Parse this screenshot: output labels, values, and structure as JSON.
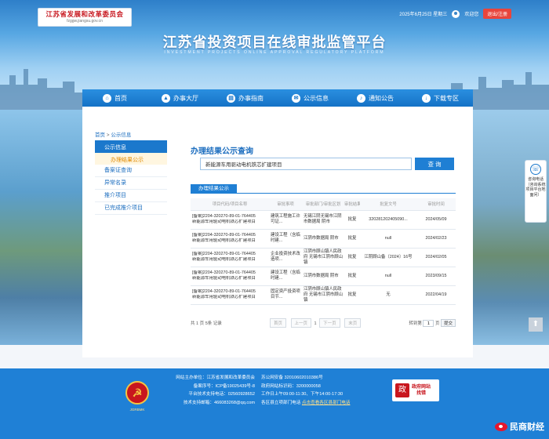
{
  "header": {
    "logo_cn": "江苏省发展和改革委员会",
    "logo_en": "fzggw.jiangsu.gov.cn",
    "date": "2025年6月25日 星期三",
    "welcome": "欢迎您",
    "logout": "退出/注册",
    "site_title": "江苏省投资项目在线审批监管平台",
    "site_subtitle": "INVESTMENT PROJECTS ONLINE APPROVAL REGULATORY PLATFORM"
  },
  "nav": {
    "items": [
      {
        "label": "首页",
        "icon": "home-icon",
        "glyph": "⌂"
      },
      {
        "label": "办事大厅",
        "icon": "hall-icon",
        "glyph": "▲"
      },
      {
        "label": "办事指南",
        "icon": "guide-icon",
        "glyph": "▤"
      },
      {
        "label": "公示信息",
        "icon": "notice-icon",
        "glyph": "✉"
      },
      {
        "label": "通知公告",
        "icon": "announcement-icon",
        "glyph": "♪"
      },
      {
        "label": "下载专区",
        "icon": "download-icon",
        "glyph": "↓"
      }
    ]
  },
  "breadcrumb": {
    "home": "首页",
    "sep": " > ",
    "current": "公示信息"
  },
  "sidebar": {
    "head": "公示信息",
    "active_sub": "办理结果公示",
    "items": [
      "备案证查询",
      "异常名录",
      "推介项目",
      "已完成推介项目"
    ]
  },
  "main": {
    "title": "办理结果公示查询",
    "search_value": "新能源车用驱动电机铁芯扩建项目",
    "search_button": "查 询",
    "tab": "办理结果公示"
  },
  "table": {
    "headers": [
      "项目代码/项目名称",
      "审批事项",
      "审批部门/审批区划",
      "审批结果",
      "批复文号",
      "审批时间"
    ],
    "rows": [
      {
        "code": "[备案]2204-320270-89-01-764405",
        "name": "新能源车用驱动电机铁芯扩建项目",
        "item": "建筑工程施工许可证...",
        "dept": "无锡江阴无锡市江阴市数据局 阴市",
        "result": "批复",
        "doc": "320281202405090...",
        "date": "2024/05/09"
      },
      {
        "code": "[备案]2204-320270-89-01-764405",
        "name": "新能源车用驱动电机铁芯扩建项目",
        "item": "建设工程（含临时建...",
        "dept": "江阴市数据局 阴市",
        "result": "批复",
        "doc": "null",
        "date": "2024/02/23"
      },
      {
        "code": "[备案]2204-320270-89-01-764405",
        "name": "新能源车用驱动电机铁芯扩建项目",
        "item": "企业投资技术改造项...",
        "dept": "江阴市顾山镇人民政府 无锡市江阴市顾山镇",
        "result": "批复",
        "doc": "江阴顾山备〔2024〕16号",
        "date": "2024/02/05"
      },
      {
        "code": "[备案]2204-320270-89-01-764405",
        "name": "新能源车用驱动电机铁芯扩建项目",
        "item": "建设工程（含临时建...",
        "dept": "江阴市数据局 阴市",
        "result": "批复",
        "doc": "null",
        "date": "2023/09/15"
      },
      {
        "code": "[备案]2204-320270-89-01-764405",
        "name": "新能源车用驱动电机铁芯扩建项目",
        "item": "固定资产投资项目节...",
        "dept": "江阴市顾山镇人民政府 无锡市江阴市顾山镇",
        "result": "批复",
        "doc": "无",
        "date": "2022/04/19"
      }
    ]
  },
  "pager": {
    "summary_prefix": "共",
    "pages": "1",
    "summary_mid": "页",
    "records": "5条",
    "summary_suffix": "记录",
    "first": "首页",
    "prev": "上一页",
    "current": "1",
    "next": "下一页",
    "last": "末页",
    "goto_label": "转到第",
    "goto_value": "1",
    "goto_suffix": "页",
    "go": "提交"
  },
  "float_phone": {
    "text": "咨询电话（咨询系统项目平台地面问）"
  },
  "back_top": {
    "glyph": "⬆"
  },
  "footer": {
    "emblem_label": "JGRBMK",
    "rows": [
      {
        "label": "网站主办单位：江苏省发展和改革委员会",
        "value": "苏公网安备 32010602010386号"
      },
      {
        "label": "备案序号：ICP备19025439号-8",
        "value": "政府网站标识码：3200000058"
      },
      {
        "label": "平台技术支持电话：02560928652",
        "value": "工作日上午09:00-11:30、下午14:00-17:30"
      },
      {
        "label": "技术支持邮箱：466083268@qq.com",
        "value": "各区县立项部门电话",
        "link": "点击查看各区县部门电话"
      }
    ],
    "report_mark": "政",
    "report_line1": "政府网站",
    "report_line2": "找错"
  },
  "watermark": "民商财经",
  "colors": {
    "primary": "#1f7fd4",
    "accent_orange": "#e08a00",
    "footer_bg": "#1f80d6",
    "logout_red": "#e8453c"
  }
}
